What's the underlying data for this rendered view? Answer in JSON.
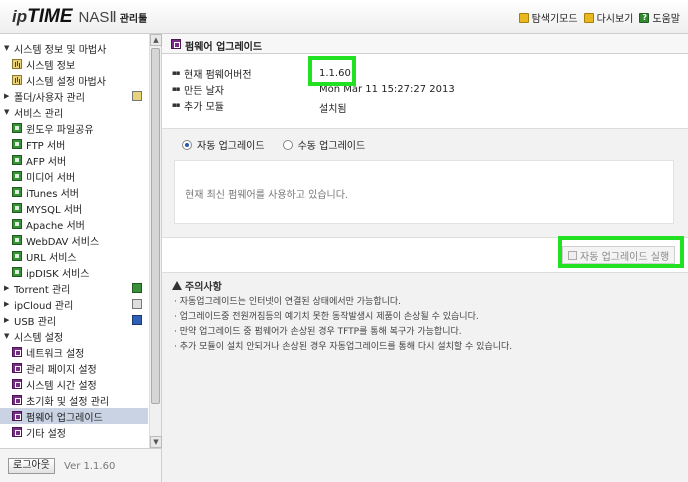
{
  "header": {
    "logo_ip": "ip",
    "logo_time": "TIME",
    "logo_model": "NASⅡ",
    "logo_suffix": "관리툴",
    "links": [
      {
        "label": "탐색기모드",
        "icon": "folder-icon"
      },
      {
        "label": "다시보기",
        "icon": "refresh-icon"
      },
      {
        "label": "도움말",
        "icon": "help-icon"
      }
    ]
  },
  "sidebar": {
    "items": [
      {
        "label": "시스템 정보 및 마법사",
        "level": "top",
        "expanded": true
      },
      {
        "label": "시스템 정보",
        "level": "child",
        "icon": "chart-icon"
      },
      {
        "label": "시스템 설정 마법사",
        "level": "child",
        "icon": "chart-icon"
      },
      {
        "label": "폴더/사용자 관리",
        "level": "top",
        "expanded": false
      },
      {
        "label": "서비스 관리",
        "level": "top",
        "expanded": true
      },
      {
        "label": "윈도우 파일공유",
        "level": "child",
        "icon": "service-icon"
      },
      {
        "label": "FTP 서버",
        "level": "child",
        "icon": "service-icon"
      },
      {
        "label": "AFP 서버",
        "level": "child",
        "icon": "service-icon"
      },
      {
        "label": "미디어 서버",
        "level": "child",
        "icon": "service-icon"
      },
      {
        "label": "iTunes 서버",
        "level": "child",
        "icon": "service-icon"
      },
      {
        "label": "MYSQL 서버",
        "level": "child",
        "icon": "service-icon"
      },
      {
        "label": "Apache 서버",
        "level": "child",
        "icon": "service-icon"
      },
      {
        "label": "WebDAV 서비스",
        "level": "child",
        "icon": "service-icon"
      },
      {
        "label": "URL 서비스",
        "level": "child",
        "icon": "service-icon"
      },
      {
        "label": "ipDISK 서비스",
        "level": "child",
        "icon": "service-icon"
      },
      {
        "label": "Torrent 관리",
        "level": "top",
        "expanded": false
      },
      {
        "label": "ipCloud 관리",
        "level": "top",
        "expanded": false
      },
      {
        "label": "USB 관리",
        "level": "top",
        "expanded": false
      },
      {
        "label": "시스템 설정",
        "level": "top",
        "expanded": true
      },
      {
        "label": "네트워크 설정",
        "level": "child",
        "icon": "settings-icon"
      },
      {
        "label": "관리 페이지 설정",
        "level": "child",
        "icon": "settings-icon"
      },
      {
        "label": "시스템 시간 설정",
        "level": "child",
        "icon": "settings-icon"
      },
      {
        "label": "초기화 및 설정 관리",
        "level": "child",
        "icon": "settings-icon"
      },
      {
        "label": "펌웨어 업그레이드",
        "level": "child",
        "icon": "settings-icon",
        "selected": true
      },
      {
        "label": "기타 설정",
        "level": "child",
        "icon": "settings-icon"
      }
    ],
    "logout_label": "로그아웃",
    "version": "Ver 1.1.60"
  },
  "main": {
    "title": "펌웨어 업그레이드",
    "info": [
      {
        "label": "현재 펌웨어버전",
        "value": "1.1.60"
      },
      {
        "label": "만든 날자",
        "value": "Mon Mar 11 15:27:27 2013"
      },
      {
        "label": "추가 모듈",
        "value": "설치됨"
      }
    ],
    "radio_auto": "자동 업그레이드",
    "radio_manual": "수동 업그레이드",
    "selected_mode": "auto",
    "message": "현재 최신 펌웨어를 사용하고 있습니다.",
    "run_button": "자동 업그레이드 실행",
    "notes_title": "주의사항",
    "notes": [
      "자동업그레이드는 인터넷이 연결된 상태에서만 가능합니다.",
      "업그레이드중 전원꺼짐등의 예기치 못한 동작발생시 제품이 손상될 수 있습니다.",
      "만약 업그레이드 중 펌웨어가 손상된 경우 TFTP를 통해 복구가 가능합니다.",
      "추가 모듈이 설치 안되거나 손상된 경우 자동업그레이드를 통해 다시 설치할 수 있습니다."
    ]
  },
  "colors": {
    "highlight": "#22e022",
    "selected_row": "#c9d3e4",
    "panel_gray": "#f2f2f2"
  }
}
